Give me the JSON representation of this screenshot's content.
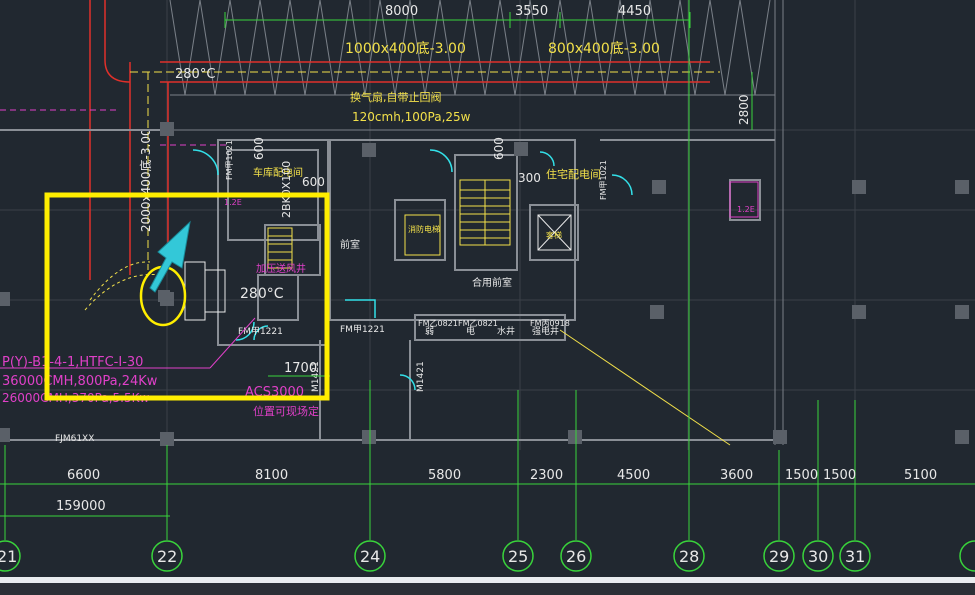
{
  "drawing": {
    "background": "#212830",
    "top_dims": [
      "8000",
      "3550",
      "4450"
    ],
    "duct_label_1": "1000x400底-3.00",
    "duct_label_2": "800x400底-3.00",
    "vertical_duct_label": "2000x400底-3.00",
    "temp_label_top": "280°C",
    "fan_note_1": "换气扇,自带止回阀",
    "fan_note_2": "120cmh,100Pa,25w",
    "dim_2800": "2800",
    "dim_600_a": "600",
    "dim_600_b": "600",
    "dim_600_c": "600",
    "dim_300": "300",
    "door_fmy102_a": "FM甲1021",
    "door_fmy102_b": "FM甲1021",
    "room_garage_switch": "车库配电间",
    "room_residential_switch": "住宅配电间",
    "duct_2bk": "2BK0X100",
    "room_front_left": "前室",
    "room_shared_front": "合用前室",
    "shaft_label": "消防电梯",
    "elevator_label": "客梯",
    "fire_shaft": "加压送风井",
    "temp_label_mid": "280°C",
    "door_fmy1221_a": "FM甲1221",
    "door_fmy1221_b": "FM甲1221",
    "door_fmz0821_a": "FM乙0821",
    "door_fmz0821_b": "FM乙0821",
    "door_fmc0918": "FM丙0918",
    "water_shaft": "水井",
    "elec_shaft": "强电井",
    "weak_shaft_a": "弱",
    "weak_shaft_b": "电",
    "dim_1700": "1700",
    "m1421_a": "M1421",
    "m1421_b": "M1421",
    "equip_1": "P(Y)-B1-4-1,HTFC-I-30",
    "equip_2": "36000CMH,800Pa,24Kw",
    "equip_3": "26000CMH,370Pa,5.5Kw",
    "acs_label": "ACS3000",
    "position_note": "位置可现场定",
    "fjm_label": "FJM61XX",
    "fm_side_a": "FM甲\n1.2E",
    "fm_side_b": "FM甲\n1.2E",
    "axis_dims": [
      "6600",
      "8100",
      "5800",
      "2300",
      "4500",
      "3600",
      "1500",
      "1500",
      "5100"
    ],
    "total_dim": "159000",
    "axis_labels": [
      "21",
      "22",
      "24",
      "25",
      "26",
      "28",
      "29",
      "30",
      "31"
    ],
    "colors": {
      "wall": "#8a8f96",
      "duct_red": "#e0302a",
      "dim_green": "#39d43b",
      "text_yellow": "#f2e04a",
      "text_magenta": "#e040c8",
      "cyan": "#33e0e8",
      "highlight": "#ffee00",
      "grid": "#5a6068",
      "white": "#e8e8e8"
    }
  }
}
